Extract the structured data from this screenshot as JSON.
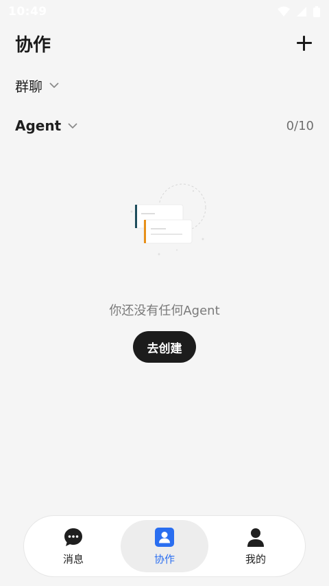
{
  "status_bar": {
    "time": "10:49"
  },
  "header": {
    "title": "协作"
  },
  "group_chat": {
    "label": "群聊"
  },
  "agent": {
    "label": "Agent",
    "count": "0/10"
  },
  "empty_state": {
    "message": "你还没有任何Agent",
    "button_label": "去创建"
  },
  "tabs": [
    {
      "label": "消息",
      "icon": "chat-bubble-icon",
      "active": false
    },
    {
      "label": "协作",
      "icon": "contact-card-icon",
      "active": true
    },
    {
      "label": "我的",
      "icon": "person-icon",
      "active": false
    }
  ],
  "colors": {
    "accent": "#2a6ef0",
    "background": "#f5f5f5",
    "button": "#1c1c1c"
  }
}
